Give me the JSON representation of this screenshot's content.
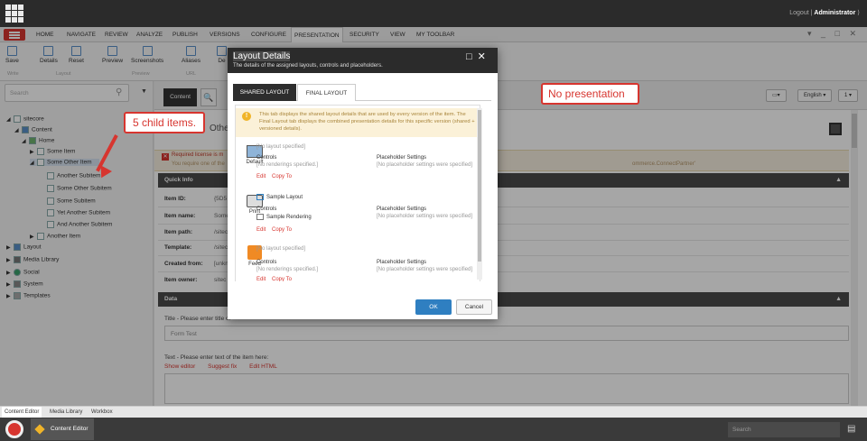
{
  "topbar": {
    "logout": "Logout",
    "separator": "|",
    "user": "Administrator"
  },
  "nav_tabs": [
    "HOME",
    "NAVIGATE",
    "REVIEW",
    "ANALYZE",
    "PUBLISH",
    "VERSIONS",
    "CONFIGURE",
    "PRESENTATION",
    "SECURITY",
    "VIEW",
    "MY TOOLBAR"
  ],
  "ribbon": {
    "buttons": [
      "Save",
      "Details",
      "Reset",
      "Preview",
      "Screenshots",
      "Aliases",
      "De"
    ],
    "groups": [
      "Write",
      "Layout",
      "Preview",
      "URL"
    ]
  },
  "search": {
    "placeholder": "Search"
  },
  "tree": [
    {
      "label": "sitecore"
    },
    {
      "label": "Content"
    },
    {
      "label": "Home"
    },
    {
      "label": "Some Item"
    },
    {
      "label": "Some Other Item"
    },
    {
      "label": "Another Subitem"
    },
    {
      "label": "Some Other Subitem"
    },
    {
      "label": "Some Subitem"
    },
    {
      "label": "Yet Another Subitem"
    },
    {
      "label": "And Another Subitem"
    },
    {
      "label": "Another Item"
    },
    {
      "label": "Layout"
    },
    {
      "label": "Media Library"
    },
    {
      "label": "Social"
    },
    {
      "label": "System"
    },
    {
      "label": "Templates"
    }
  ],
  "annotations": {
    "child_items": "5 child items.",
    "no_presentation": "No presentation"
  },
  "content_tab": {
    "label": "Content",
    "search_icon": "🔍"
  },
  "top_right": {
    "lang": "English ▾",
    "num": "1 ▾"
  },
  "item_title": "Othe",
  "warning": {
    "line1": "Required license is m",
    "line2": "You require one of the",
    "line3": "ommerce.ConnectPartner'"
  },
  "quick_info": {
    "title": "Quick Info",
    "fields": [
      {
        "label": "Item ID:",
        "value": "{5D5"
      },
      {
        "label": "Item name:",
        "value": "Some"
      },
      {
        "label": "Item path:",
        "value": "/sitec"
      },
      {
        "label": "Template:",
        "value": "/sitec"
      },
      {
        "label": "Created from:",
        "value": "[unkn"
      },
      {
        "label": "Item owner:",
        "value": "sitec"
      }
    ]
  },
  "data_section": {
    "title": "Data",
    "title_label": "Title - Please enter title of",
    "title_value": "Form Test",
    "text_label": "Text - Please enter text of the item here:",
    "links": [
      "Show editor",
      "Suggest fix",
      "Edit HTML"
    ]
  },
  "bottom_tabs": [
    "Content Editor",
    "Media Library",
    "Workbox"
  ],
  "taskbar": {
    "item": "Content Editor",
    "search": "Search"
  },
  "modal": {
    "title": "Layout Details",
    "subtitle": "The details of the assigned layouts, controls and placeholders.",
    "tabs": [
      "SHARED LAYOUT",
      "FINAL LAYOUT"
    ],
    "info": "This tab displays the shared layout details that are used by every version of the item. The Final Layout tab displays the combined presentation details for this specific version (shared + versioned details).",
    "devices": [
      {
        "name": "Default",
        "layout": "[No layout specified]",
        "controls_label": "Controls",
        "controls": "[No renderings specified.]",
        "ph_label": "Placeholder Settings",
        "ph": "[No placeholder settings were specified]",
        "edit": "Edit",
        "copy": "Copy To"
      },
      {
        "name": "Print",
        "layout": "Sample Layout",
        "controls_label": "Controls",
        "controls": "Sample Rendering",
        "ph_label": "Placeholder Settings",
        "ph": "[No placeholder settings were specified]",
        "edit": "Edit",
        "copy": "Copy To"
      },
      {
        "name": "Feed",
        "layout": "[No layout specified]",
        "controls_label": "Controls",
        "controls": "[No renderings specified.]",
        "ph_label": "Placeholder Settings",
        "ph": "[No placeholder settings were specified]",
        "edit": "Edit",
        "copy": "Copy To"
      }
    ],
    "ok": "OK",
    "cancel": "Cancel"
  },
  "colors": {
    "accent": "#d7352f",
    "primary": "#2f7fc1",
    "dark": "#2b2b2b"
  }
}
